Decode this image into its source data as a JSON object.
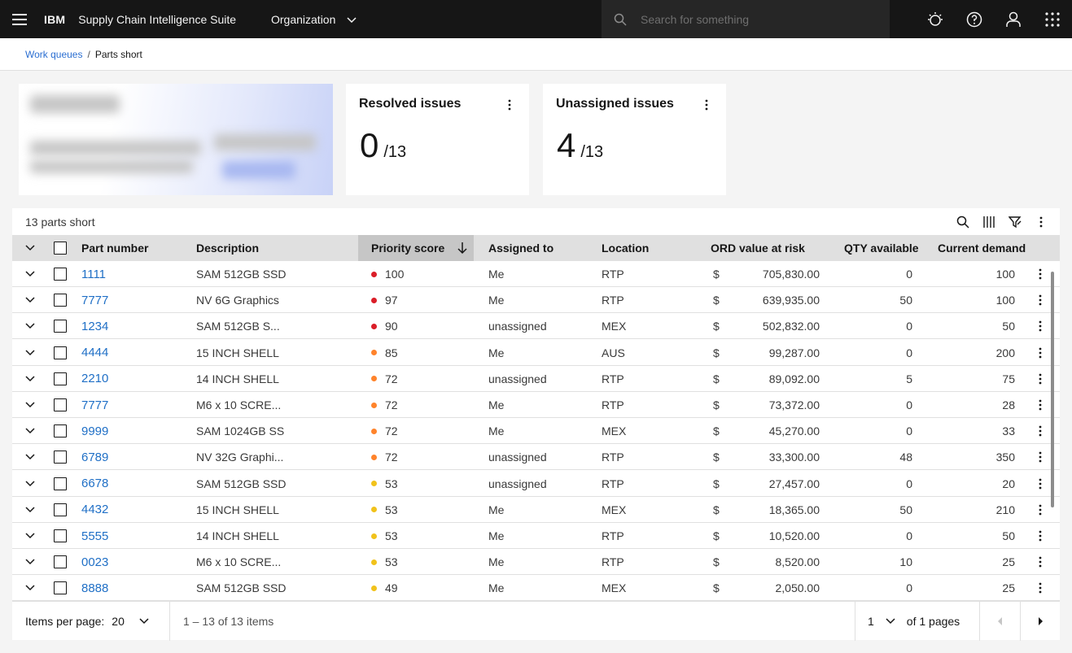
{
  "header": {
    "brand": "IBM",
    "product": "Supply Chain Intelligence Suite",
    "org_label": "Organization",
    "search_placeholder": "Search for something",
    "icons": [
      "watson-icon",
      "help-icon",
      "user-icon",
      "app-switcher-icon"
    ]
  },
  "breadcrumb": {
    "link": "Work queues",
    "separator": "/",
    "current": "Parts short"
  },
  "cards": [
    {
      "title": "Resolved issues",
      "value": "0",
      "total": "/13"
    },
    {
      "title": "Unassigned issues",
      "value": "4",
      "total": "/13"
    }
  ],
  "table": {
    "title": "13 parts short",
    "columns": {
      "part_number": "Part number",
      "description": "Description",
      "priority": "Priority score",
      "assigned": "Assigned to",
      "location": "Location",
      "ord_value": "ORD value at risk",
      "qty": "QTY available",
      "demand": "Current demand"
    },
    "currency": "$",
    "colors": {
      "high": "#da1e28",
      "medium": "#ff832b",
      "low": "#f1c21b"
    },
    "rows": [
      {
        "part": "1111",
        "desc": "SAM 512GB SSD",
        "score": "100",
        "level": "high",
        "assigned": "Me",
        "loc": "RTP",
        "value": "705,830.00",
        "qty": "0",
        "demand": "100"
      },
      {
        "part": "7777",
        "desc": "NV 6G Graphics",
        "score": "97",
        "level": "high",
        "assigned": "Me",
        "loc": "RTP",
        "value": "639,935.00",
        "qty": "50",
        "demand": "100"
      },
      {
        "part": "1234",
        "desc": "SAM 512GB S...",
        "score": "90",
        "level": "high",
        "assigned": "unassigned",
        "loc": "MEX",
        "value": "502,832.00",
        "qty": "0",
        "demand": "50"
      },
      {
        "part": "4444",
        "desc": "15 INCH SHELL",
        "score": "85",
        "level": "medium",
        "assigned": "Me",
        "loc": "AUS",
        "value": "99,287.00",
        "qty": "0",
        "demand": "200"
      },
      {
        "part": "2210",
        "desc": "14 INCH SHELL",
        "score": "72",
        "level": "medium",
        "assigned": "unassigned",
        "loc": "RTP",
        "value": "89,092.00",
        "qty": "5",
        "demand": "75"
      },
      {
        "part": "7777",
        "desc": "M6 x 10 SCRE...",
        "score": "72",
        "level": "medium",
        "assigned": "Me",
        "loc": "RTP",
        "value": "73,372.00",
        "qty": "0",
        "demand": "28"
      },
      {
        "part": "9999",
        "desc": "SAM 1024GB SS",
        "score": "72",
        "level": "medium",
        "assigned": "Me",
        "loc": "MEX",
        "value": "45,270.00",
        "qty": "0",
        "demand": "33"
      },
      {
        "part": "6789",
        "desc": "NV 32G Graphi...",
        "score": "72",
        "level": "medium",
        "assigned": "unassigned",
        "loc": "RTP",
        "value": "33,300.00",
        "qty": "48",
        "demand": "350"
      },
      {
        "part": "6678",
        "desc": "SAM 512GB SSD",
        "score": "53",
        "level": "low",
        "assigned": "unassigned",
        "loc": "RTP",
        "value": "27,457.00",
        "qty": "0",
        "demand": "20"
      },
      {
        "part": "4432",
        "desc": "15 INCH SHELL",
        "score": "53",
        "level": "low",
        "assigned": "Me",
        "loc": "MEX",
        "value": "18,365.00",
        "qty": "50",
        "demand": "210"
      },
      {
        "part": "5555",
        "desc": "14 INCH SHELL",
        "score": "53",
        "level": "low",
        "assigned": "Me",
        "loc": "RTP",
        "value": "10,520.00",
        "qty": "0",
        "demand": "50"
      },
      {
        "part": "0023",
        "desc": "M6 x 10 SCRE...",
        "score": "53",
        "level": "low",
        "assigned": "Me",
        "loc": "RTP",
        "value": "8,520.00",
        "qty": "10",
        "demand": "25"
      },
      {
        "part": "8888",
        "desc": "SAM 512GB SSD",
        "score": "49",
        "level": "low",
        "assigned": "Me",
        "loc": "MEX",
        "value": "2,050.00",
        "qty": "0",
        "demand": "25"
      }
    ]
  },
  "pagination": {
    "items_per_page_label": "Items per page:",
    "items_per_page": "20",
    "range": "1 – 13 of 13 items",
    "page": "1",
    "of_pages": "of 1 pages"
  }
}
